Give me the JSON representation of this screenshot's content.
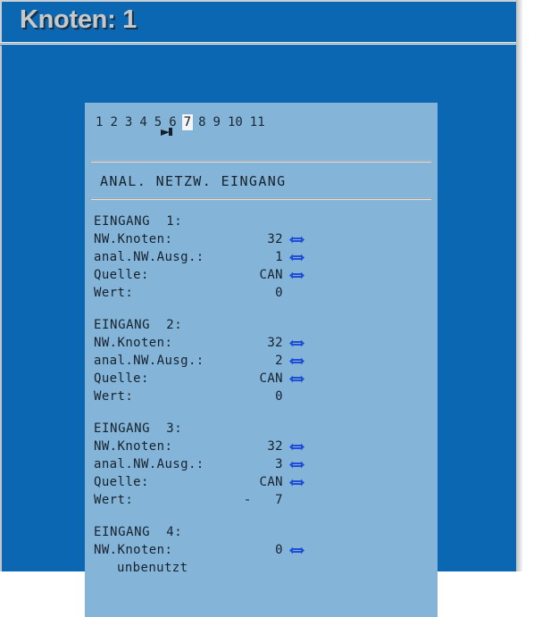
{
  "window": {
    "title": "Knoten: 1",
    "background_color": "#0b67b2",
    "panel_color": "#84b5d9"
  },
  "page_selector": {
    "numbers": [
      "1",
      "2",
      "3",
      "4",
      "5",
      "6",
      "7",
      "8",
      "9",
      "10",
      "11"
    ],
    "selected": "7"
  },
  "panel": {
    "section_title": "ANAL. NETZW. EINGANG",
    "arrow_icon": "left-right-arrow",
    "arrow_color": "#1f4fd6"
  },
  "entries": [
    {
      "heading": "EINGANG  1:",
      "fields": [
        {
          "label": "NW.Knoten:",
          "value": "32",
          "arrow": true
        },
        {
          "label": "anal.NW.Ausg.:",
          "value": "1",
          "arrow": true
        },
        {
          "label": "Quelle:",
          "value": "CAN",
          "arrow": true
        },
        {
          "label": "Wert:",
          "value": "0",
          "arrow": false
        }
      ],
      "note": null
    },
    {
      "heading": "EINGANG  2:",
      "fields": [
        {
          "label": "NW.Knoten:",
          "value": "32",
          "arrow": true
        },
        {
          "label": "anal.NW.Ausg.:",
          "value": "2",
          "arrow": true
        },
        {
          "label": "Quelle:",
          "value": "CAN",
          "arrow": true
        },
        {
          "label": "Wert:",
          "value": "0",
          "arrow": false
        }
      ],
      "note": null
    },
    {
      "heading": "EINGANG  3:",
      "fields": [
        {
          "label": "NW.Knoten:",
          "value": "32",
          "arrow": true
        },
        {
          "label": "anal.NW.Ausg.:",
          "value": "3",
          "arrow": true
        },
        {
          "label": "Quelle:",
          "value": "CAN",
          "arrow": true
        },
        {
          "label": "Wert:",
          "value": "-   7",
          "arrow": false
        }
      ],
      "note": null
    },
    {
      "heading": "EINGANG  4:",
      "fields": [
        {
          "label": "NW.Knoten:",
          "value": "0",
          "arrow": true
        }
      ],
      "note": "unbenutzt"
    }
  ]
}
